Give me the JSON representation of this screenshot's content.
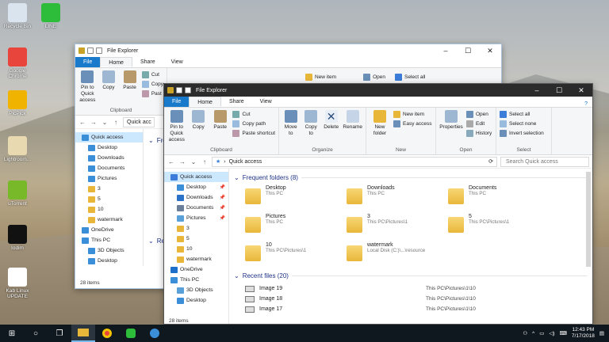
{
  "desktop": {
    "icons": [
      {
        "label": "Recycle Bin",
        "color": "#d9e4ef"
      },
      {
        "label": "LINE",
        "color": "#2dbd3a"
      },
      {
        "label": "Google Chrome",
        "color": "#e8453c"
      },
      {
        "label": "PicPick",
        "color": "#f0b400"
      },
      {
        "label": "Lightroom...",
        "color": "#e8d9b0"
      },
      {
        "label": "uTorrent",
        "color": "#78b929"
      },
      {
        "label": "Iodim",
        "color": "#111111"
      },
      {
        "label": "Kab Linux UPDATE",
        "color": "#ffffff"
      }
    ]
  },
  "back_window": {
    "title": "File Explorer",
    "tabs": [
      "File",
      "Home",
      "Share",
      "View"
    ],
    "pin_label": "Pin to Quick access",
    "copy_label": "Copy",
    "paste_label": "Paste",
    "cut_label": "Cut",
    "copy_path_label": "Copy",
    "paste_shortcut_label": "Past",
    "clipboard_label": "Clipboard",
    "new_item_label": "New item",
    "open_label": "Open",
    "select_all_label": "Select all",
    "address": "Quick acc",
    "nav": [
      "Quick access",
      "Desktop",
      "Downloads",
      "Documents",
      "Pictures",
      "3",
      "5",
      "10",
      "watermark",
      "OneDrive",
      "This PC",
      "3D Objects",
      "Desktop"
    ],
    "status": "28 items",
    "frag1": "Fre",
    "frag2": "Rec"
  },
  "front_window": {
    "title": "File Explorer",
    "tabs": [
      "File",
      "Home",
      "Share",
      "View"
    ],
    "clipboard": {
      "pin": "Pin to Quick access",
      "copy": "Copy",
      "paste": "Paste",
      "cut": "Cut",
      "copy_path": "Copy path",
      "paste_shortcut": "Paste shortcut",
      "label": "Clipboard"
    },
    "organize": {
      "move_to": "Move to",
      "copy_to": "Copy to",
      "delete": "Delete",
      "rename": "Rename",
      "label": "Organize"
    },
    "new": {
      "new_folder": "New folder",
      "new_item": "New item",
      "easy_access": "Easy access",
      "label": "New"
    },
    "open": {
      "properties": "Properties",
      "open": "Open",
      "edit": "Edit",
      "history": "History",
      "label": "Open"
    },
    "select": {
      "select_all": "Select all",
      "select_none": "Select none",
      "invert": "Invert selection",
      "label": "Select"
    },
    "address": "Quick access",
    "search_placeholder": "Search Quick access",
    "nav": [
      {
        "label": "Quick access",
        "sel": true,
        "sub": false,
        "pin": false,
        "color": "#3b7dd8"
      },
      {
        "label": "Desktop",
        "sub": true,
        "pin": true,
        "color": "#3b8fd8"
      },
      {
        "label": "Downloads",
        "sub": true,
        "pin": true,
        "color": "#2a72c8"
      },
      {
        "label": "Documents",
        "sub": true,
        "pin": true,
        "color": "#6a7f99"
      },
      {
        "label": "Pictures",
        "sub": true,
        "pin": true,
        "color": "#5aa0d8"
      },
      {
        "label": "3",
        "sub": true,
        "pin": false,
        "color": "#e8b739"
      },
      {
        "label": "5",
        "sub": true,
        "pin": false,
        "color": "#e8b739"
      },
      {
        "label": "10",
        "sub": true,
        "pin": false,
        "color": "#e8b739"
      },
      {
        "label": "watermark",
        "sub": true,
        "pin": false,
        "color": "#e8b739"
      },
      {
        "label": "OneDrive",
        "sub": false,
        "pin": false,
        "color": "#1e6fc9"
      },
      {
        "label": "This PC",
        "sub": false,
        "pin": false,
        "color": "#3b8fd8"
      },
      {
        "label": "3D Objects",
        "sub": true,
        "pin": false,
        "color": "#5aa0d8"
      },
      {
        "label": "Desktop",
        "sub": true,
        "pin": false,
        "color": "#3b8fd8"
      }
    ],
    "frequent_header": "Frequent folders (8)",
    "folders": [
      {
        "name": "Desktop",
        "loc": "This PC"
      },
      {
        "name": "Downloads",
        "loc": "This PC"
      },
      {
        "name": "Documents",
        "loc": "This PC"
      },
      {
        "name": "Pictures",
        "loc": "This PC"
      },
      {
        "name": "3",
        "loc": "This PC\\Pictures\\1"
      },
      {
        "name": "5",
        "loc": "This PC\\Pictures\\1"
      },
      {
        "name": "10",
        "loc": "This PC\\Pictures\\1"
      },
      {
        "name": "watermark",
        "loc": "Local Disk (C:)\\...\\resource"
      }
    ],
    "recent_header": "Recent files (20)",
    "recent": [
      {
        "name": "Image 19",
        "path": "This PC\\Pictures\\1\\10"
      },
      {
        "name": "Image 18",
        "path": "This PC\\Pictures\\1\\10"
      },
      {
        "name": "Image 17",
        "path": "This PC\\Pictures\\1\\10"
      }
    ],
    "status": "28 items"
  },
  "taskbar": {
    "start": "⊞",
    "time": "12:43 PM",
    "date": "7/17/2018"
  }
}
